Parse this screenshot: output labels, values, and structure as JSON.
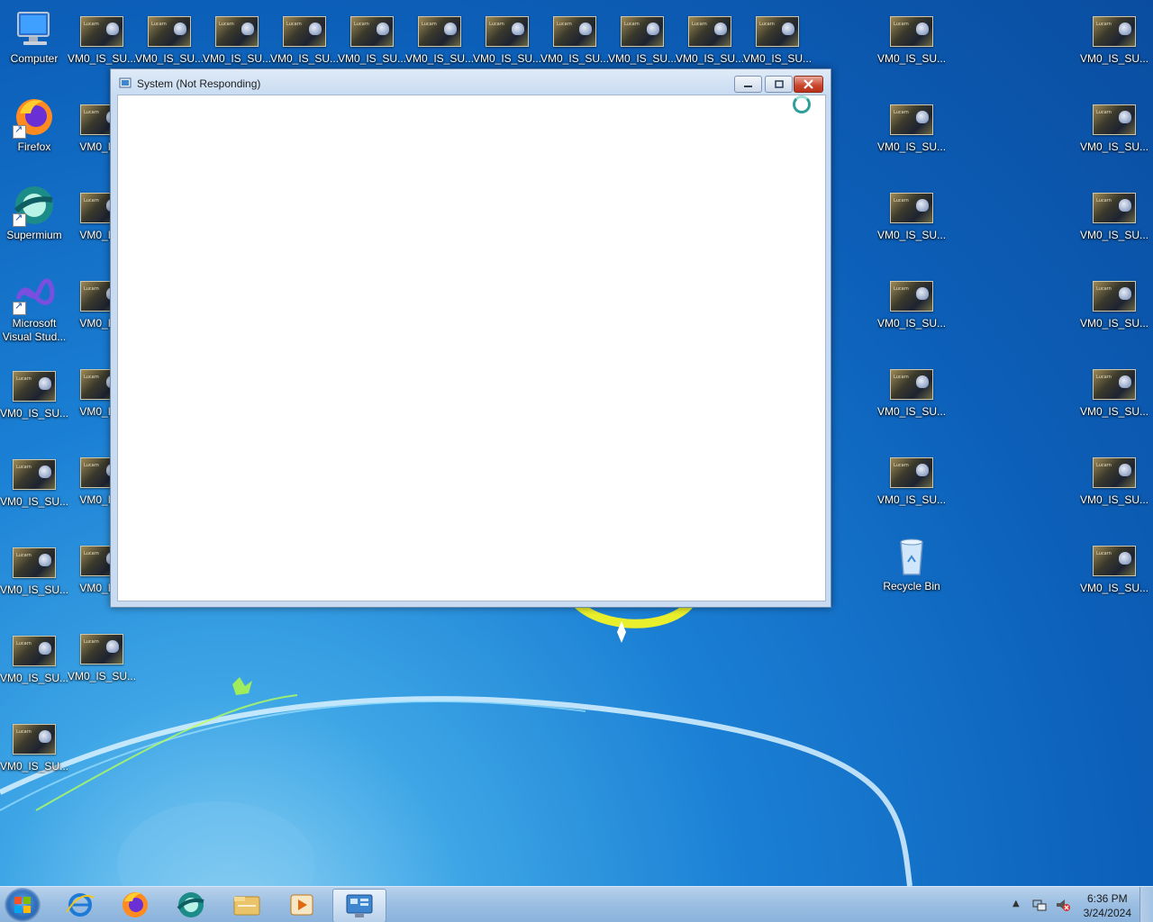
{
  "desktop": {
    "icons": {
      "computer": "Computer",
      "firefox": "Firefox",
      "supermium": "Supermium",
      "msvs_line1": "Microsoft",
      "msvs_line2": "Visual Stud...",
      "recycle_bin": "Recycle Bin",
      "vm_full": "VM0_IS_SU...",
      "vm_clipped": "VM0_IS_"
    }
  },
  "window": {
    "title": "System (Not Responding)",
    "state": "not responding"
  },
  "taskbar": {
    "apps": [
      "start-button",
      "internet-explorer",
      "firefox",
      "supermium",
      "file-explorer",
      "media-player",
      "system"
    ],
    "clock_time": "6:36 PM",
    "clock_date": "3/24/2024"
  },
  "colors": {
    "desktop_blue": "#0c5fb8",
    "close_red": "#c9452c",
    "taskbar": "#9cbfe2"
  }
}
